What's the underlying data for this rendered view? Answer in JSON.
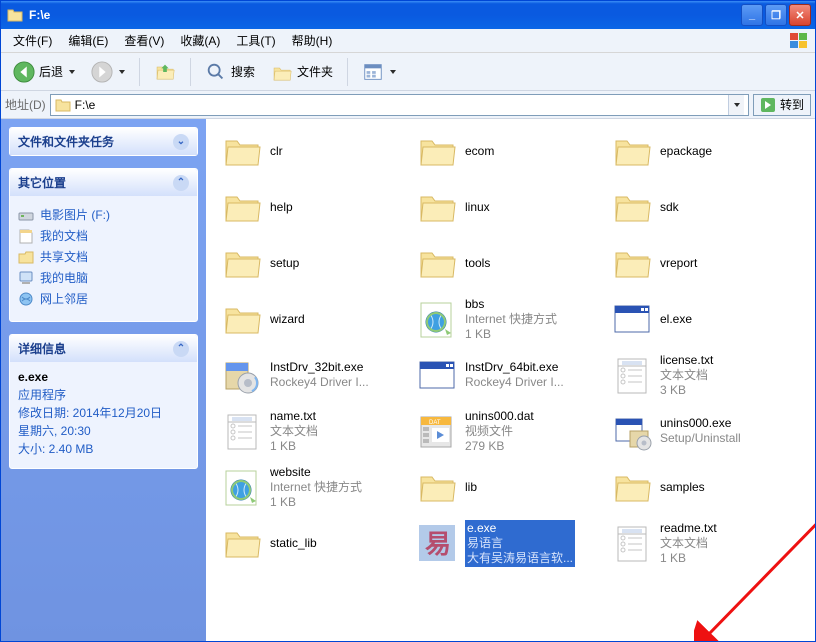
{
  "window": {
    "title": "F:\\e"
  },
  "menu": {
    "file": "文件(F)",
    "edit": "编辑(E)",
    "view": "查看(V)",
    "fav": "收藏(A)",
    "tools": "工具(T)",
    "help": "帮助(H)"
  },
  "toolbar": {
    "back": "后退",
    "search": "搜索",
    "folders": "文件夹"
  },
  "address": {
    "label": "地址(D)",
    "value": "F:\\e",
    "go": "转到"
  },
  "side": {
    "tasks_title": "文件和文件夹任务",
    "places_title": "其它位置",
    "places": [
      {
        "icon": "drive",
        "label": "电影图片 (F:)"
      },
      {
        "icon": "docs",
        "label": "我的文档"
      },
      {
        "icon": "folder",
        "label": "共享文档"
      },
      {
        "icon": "pc",
        "label": "我的电脑"
      },
      {
        "icon": "net",
        "label": "网上邻居"
      }
    ],
    "details_title": "详细信息",
    "details": {
      "name": "e.exe",
      "type": "应用程序",
      "mod_label": "修改日期: 2014年12月20日",
      "mod_time": "星期六, 20:30",
      "size": "大小: 2.40 MB"
    }
  },
  "items": [
    {
      "icon": "folder",
      "name": "clr"
    },
    {
      "icon": "folder",
      "name": "ecom"
    },
    {
      "icon": "folder",
      "name": "epackage"
    },
    {
      "icon": "folder",
      "name": "help"
    },
    {
      "icon": "folder",
      "name": "linux"
    },
    {
      "icon": "folder",
      "name": "sdk"
    },
    {
      "icon": "folder",
      "name": "setup"
    },
    {
      "icon": "folder",
      "name": "tools"
    },
    {
      "icon": "folder",
      "name": "vreport"
    },
    {
      "icon": "folder",
      "name": "wizard"
    },
    {
      "icon": "url",
      "name": "bbs",
      "sub": "Internet 快捷方式",
      "sub2": "1 KB"
    },
    {
      "icon": "exe-window",
      "name": "el.exe"
    },
    {
      "icon": "installer",
      "name": "InstDrv_32bit.exe",
      "sub": "Rockey4 Driver I..."
    },
    {
      "icon": "exe-window",
      "name": "InstDrv_64bit.exe",
      "sub": "Rockey4 Driver I..."
    },
    {
      "icon": "txt",
      "name": "license.txt",
      "sub": "文本文档",
      "sub2": "3 KB"
    },
    {
      "icon": "txt",
      "name": "name.txt",
      "sub": "文本文档",
      "sub2": "1 KB"
    },
    {
      "icon": "dat",
      "name": "unins000.dat",
      "sub": "视频文件",
      "sub2": "279 KB"
    },
    {
      "icon": "uninstall",
      "name": "unins000.exe",
      "sub": "Setup/Uninstall"
    },
    {
      "icon": "url",
      "name": "website",
      "sub": "Internet 快捷方式",
      "sub2": "1 KB"
    },
    {
      "icon": "folder",
      "name": "lib"
    },
    {
      "icon": "folder",
      "name": "samples"
    },
    {
      "icon": "folder",
      "name": "static_lib"
    },
    {
      "icon": "e",
      "name": "e.exe",
      "sub": "易语言",
      "sub2": "大有吴涛易语言软...",
      "selected": true
    },
    {
      "icon": "txt",
      "name": "readme.txt",
      "sub": "文本文档",
      "sub2": "1 KB"
    }
  ]
}
